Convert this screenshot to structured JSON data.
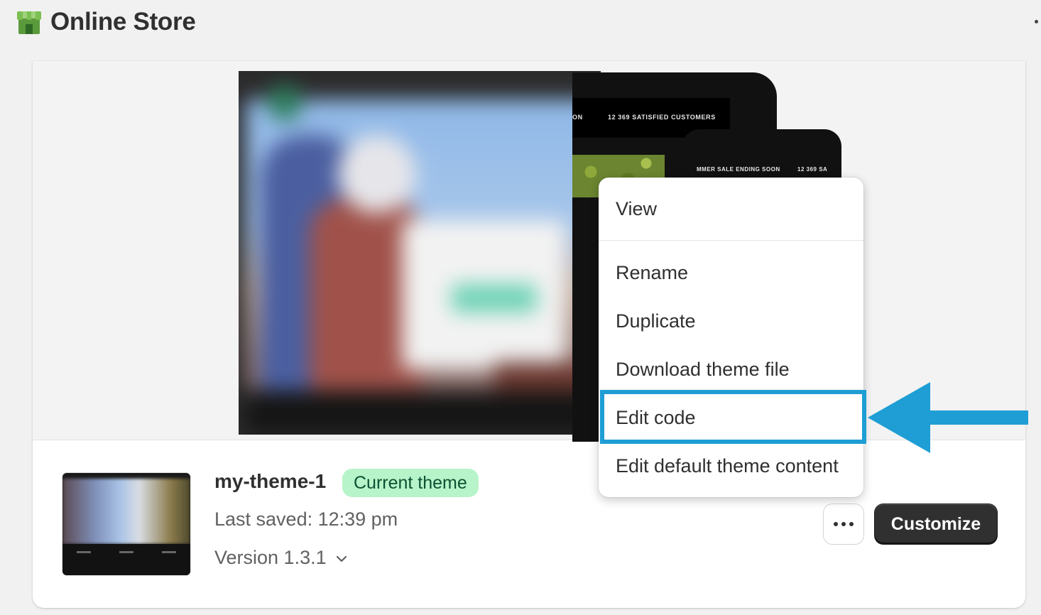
{
  "header": {
    "title": "Online Store",
    "icon": "storefront-icon"
  },
  "preview": {
    "tablet_caption_left": "ON",
    "tablet_caption": "12 369 SATISFIED CUSTOMERS",
    "phone_caption": "MMER SALE ENDING SOON",
    "phone_caption_right": "12 369 SA"
  },
  "menu": {
    "items": [
      {
        "label": "View"
      },
      {
        "label": "Rename"
      },
      {
        "label": "Duplicate"
      },
      {
        "label": "Download theme file"
      },
      {
        "label": "Edit code"
      },
      {
        "label": "Edit default theme content"
      }
    ]
  },
  "theme": {
    "name": "my-theme-1",
    "badge": "Current theme",
    "last_saved": "Last saved: 12:39 pm",
    "version": "Version 1.3.1"
  },
  "actions": {
    "more_icon": "ellipsis-icon",
    "customize_label": "Customize"
  },
  "colors": {
    "highlight": "#1e9ed4",
    "badge_bg": "#b7f4c9",
    "badge_text": "#0c5132",
    "primary_button": "#303030",
    "logo_green": "#5b9a3c"
  }
}
